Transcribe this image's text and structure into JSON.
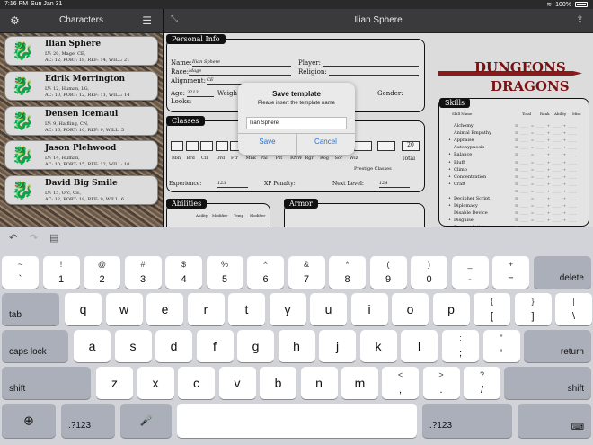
{
  "status": {
    "time": "7:16 PM",
    "date": "Sun Jan 31",
    "battery": "100%"
  },
  "left": {
    "title": "Characters",
    "characters": [
      {
        "name": "Ilian Sphere",
        "line1": "LV: 20, Mage, CE,",
        "line2": "AC: 12, FORT: 18, REF: 14, WILL: 21"
      },
      {
        "name": "Edrik Morrington",
        "line1": "LV: 12, Human, LG,",
        "line2": "AC: 10, FORT: 12, REF: 11, WILL: 14"
      },
      {
        "name": "Densen Icemaul",
        "line1": "LV: 9, Halfling, CN,",
        "line2": "AC: 16, FORT: 10, REF: 9, WILL: 5"
      },
      {
        "name": "Jason Plehwood",
        "line1": "LV: 14, Human,",
        "line2": "AC: 10, FORT: 15, REF: 12, WILL: 10"
      },
      {
        "name": "David Big Smile",
        "line1": "LV: 15, Orc, CE,",
        "line2": "AC: 12, FORT: 18, REF: 9, WILL: 6"
      }
    ]
  },
  "right": {
    "title": "Ilian Sphere"
  },
  "sheet": {
    "personal_info_tab": "Personal Info",
    "name_label": "Name:",
    "name_value": "Ilian Sphere",
    "race_label": "Race:",
    "race_value": "Mage",
    "alignment_label": "Alignment:",
    "alignment_value": "CE",
    "age_label": "Age:",
    "age_value": "3213",
    "weight_label": "Weigh",
    "looks_label": "Looks:",
    "player_label": "Player:",
    "religion_label": "Religion:",
    "gender_label": "Gender:",
    "classes_tab": "Classes",
    "class_value": "20",
    "class_abbrevs": [
      "Bbn",
      "Brd",
      "Clr",
      "Drd",
      "Ftr",
      "Mnk",
      "Pal",
      "Pst",
      "RNW",
      "Rgr",
      "Rog",
      "Sor",
      "Wiz"
    ],
    "total_label": "Total",
    "prestige_label": "Prestige Classes",
    "experience_label": "Experience:",
    "experience_value": "123",
    "xp_penalty_label": "XP Penalty:",
    "next_level_label": "Next Level:",
    "next_level_value": "124",
    "abilities_tab": "Abilities",
    "abilities_headers": [
      "Ability",
      "Modifier",
      "Temp",
      "Modifier"
    ],
    "armor_tab": "Armor",
    "logo_line1": "DUNGEONS",
    "logo_line2": "DRAGONS",
    "skills_tab": "Skills",
    "skills_headers": [
      "Skill Name",
      "Total",
      "Rank",
      "Ability",
      "Misc"
    ],
    "skills": [
      "Alchemy",
      "Animal Empathy",
      "Appraise",
      "Autohypnosis",
      "Balance",
      "Bluff",
      "Climb",
      "Concentration",
      "Craft",
      "",
      "Decipher Script",
      "Diplomacy",
      "Disable Device",
      "Disguise",
      "Escape Artist"
    ],
    "skill_bullets": [
      false,
      false,
      true,
      false,
      true,
      true,
      true,
      true,
      true,
      false,
      true,
      true,
      false,
      true,
      false
    ]
  },
  "modal": {
    "title": "Save template",
    "message": "Please insert the template name",
    "input_value": "Ilian Sphere",
    "save": "Save",
    "cancel": "Cancel"
  },
  "keyboard": {
    "row1": [
      [
        "~",
        "`"
      ],
      [
        "!",
        "1"
      ],
      [
        "@",
        "2"
      ],
      [
        "#",
        "3"
      ],
      [
        "$",
        "4"
      ],
      [
        "%",
        "5"
      ],
      [
        "^",
        "6"
      ],
      [
        "&",
        "7"
      ],
      [
        "*",
        "8"
      ],
      [
        "(",
        "9"
      ],
      [
        ")",
        "0"
      ],
      [
        "_",
        "-"
      ],
      [
        "+",
        "="
      ]
    ],
    "delete": "delete",
    "tab": "tab",
    "row2": [
      "q",
      "w",
      "e",
      "r",
      "t",
      "y",
      "u",
      "i",
      "o",
      "p"
    ],
    "row2b": [
      [
        "{",
        "["
      ],
      [
        "}",
        "]"
      ],
      [
        "|",
        "\\"
      ]
    ],
    "caps": "caps lock",
    "row3": [
      "a",
      "s",
      "d",
      "f",
      "g",
      "h",
      "j",
      "k",
      "l"
    ],
    "row3b": [
      [
        ":",
        ";"
      ],
      [
        "”",
        "’"
      ]
    ],
    "return": "return",
    "shift": "shift",
    "row4": [
      "z",
      "x",
      "c",
      "v",
      "b",
      "n",
      "m"
    ],
    "row4b": [
      [
        "<",
        ","
      ],
      [
        ">",
        "."
      ],
      [
        "?",
        "/"
      ]
    ],
    "numkey": ".?123"
  }
}
